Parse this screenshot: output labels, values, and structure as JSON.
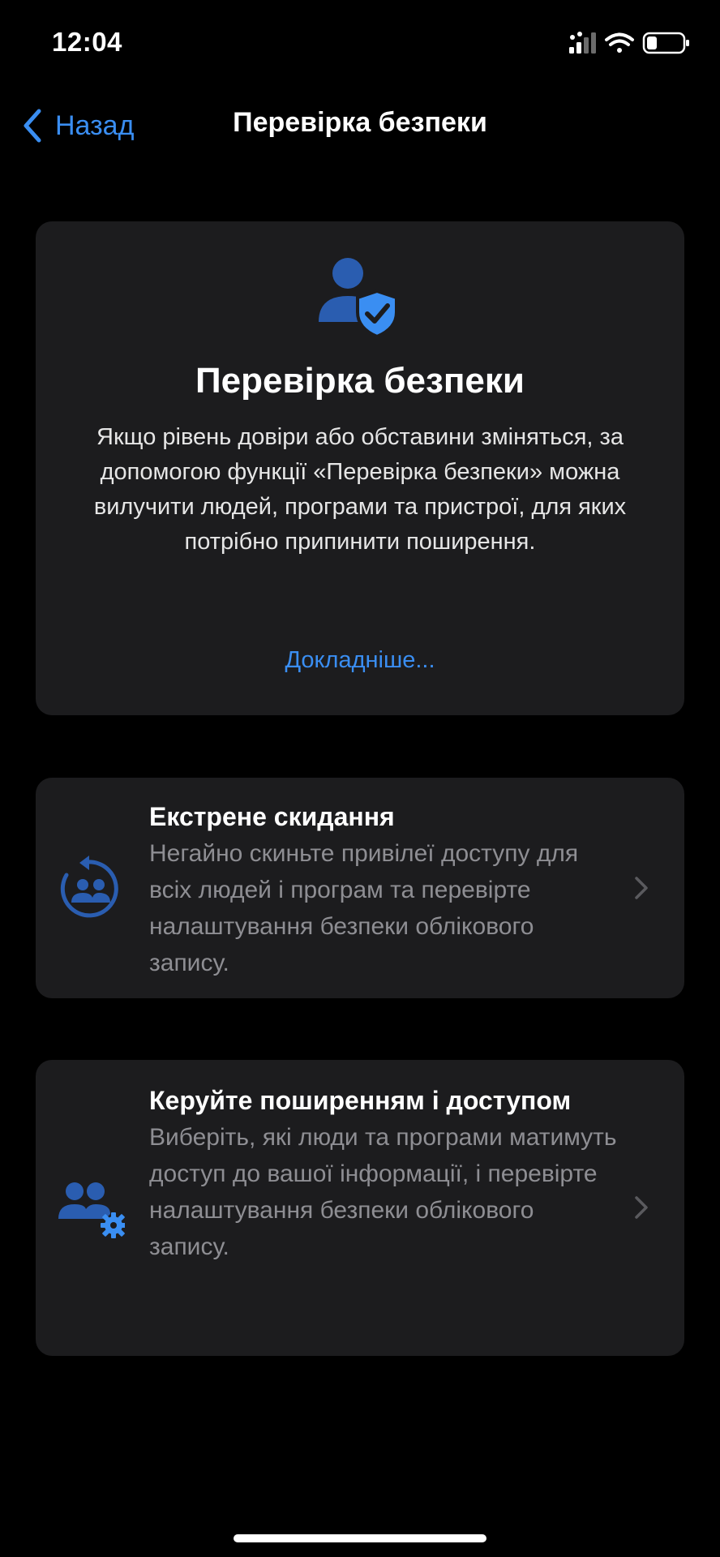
{
  "status_bar": {
    "time": "12:04"
  },
  "nav": {
    "back_label": "Назад",
    "title": "Перевірка безпеки"
  },
  "hero": {
    "icon": "person-shield-check-icon",
    "title": "Перевірка безпеки",
    "description": "Якщо рівень довіри або обставини зміняться, за допомогою функції «Перевірка безпеки» можна вилучити людей, програми та пристрої, для яких потрібно припинити поширення.",
    "link_label": "Докладніше..."
  },
  "options": [
    {
      "icon": "emergency-reset-icon",
      "title": "Екстрене скидання",
      "description": "Негайно скиньте привілеї доступу для всіх людей і програм та перевірте налаштування безпеки облікового запису."
    },
    {
      "icon": "people-gear-icon",
      "title": "Керуйте поширенням і доступом",
      "description": "Виберіть, які люди та програми матимуть доступ до вашої інформації, і перевірте налаштування безпеки облікового запису."
    }
  ],
  "colors": {
    "background": "#000000",
    "card": "#1c1c1e",
    "accent": "#3a8ef2",
    "icon_dark_blue": "#2a5db0",
    "secondary_text": "#8e8e93"
  }
}
